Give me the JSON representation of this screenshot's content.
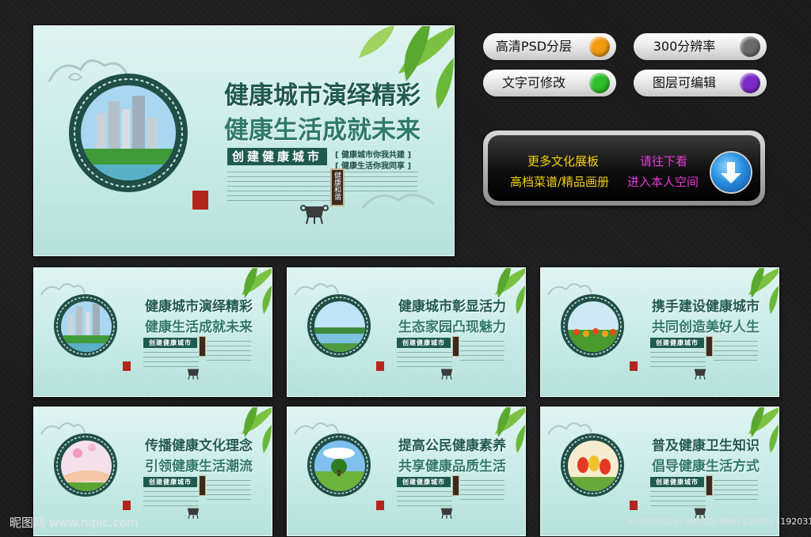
{
  "features": [
    {
      "label": "高清PSD分层",
      "dot_color": "#f39a10"
    },
    {
      "label": "300分辨率",
      "dot_color": "#6b6b6b"
    },
    {
      "label": "文字可修改",
      "dot_color": "#2fbf2a"
    },
    {
      "label": "图层可编辑",
      "dot_color": "#7a2bc8"
    }
  ],
  "promo": {
    "line1_left": "更多文化展板",
    "line1_right": "请往下看",
    "line2_left": "高档菜谱/精品画册",
    "line2_right": "进入本人空间",
    "left_color": "#f5d10a",
    "right_color": "#e63ad8",
    "button_icon": "download-arrow-icon"
  },
  "main_panel": {
    "title1": "健康城市演绎精彩",
    "title2": "健康生活成就未来",
    "banner": "创建健康城市",
    "slogan1": "[ 健康城市你我共建 ]",
    "slogan2": "[ 健康生活你我同享 ]",
    "vertical": "健康和谐"
  },
  "thumbnails": [
    {
      "title1": "健康城市演绎精彩",
      "title2": "健康生活成就未来",
      "scene": "city"
    },
    {
      "title1": "健康城市彰显活力",
      "title2": "生态家园凸现魅力",
      "scene": "lake"
    },
    {
      "title1": "携手建设健康城市",
      "title2": "共同创造美好人生",
      "scene": "tulips"
    },
    {
      "title1": "传播健康文化理念",
      "title2": "引领健康生活潮流",
      "scene": "hands"
    },
    {
      "title1": "提高公民健康素养",
      "title2": "共享健康品质生活",
      "scene": "meadow"
    },
    {
      "title1": "普及健康卫生知识",
      "title2": "倡导健康生活方式",
      "scene": "flowers"
    }
  ],
  "thumb_banner": "创建健康城市",
  "watermark": "昵图网 www.nipic.com",
  "id_text": "ID:19210155 NO:20180411230011192031"
}
